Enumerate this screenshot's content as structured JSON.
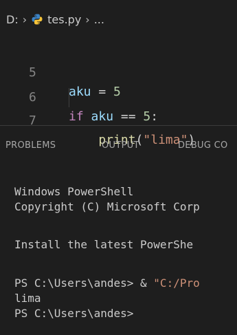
{
  "breadcrumb": {
    "drive": "D:",
    "separator": "›",
    "file": "tes.py",
    "more": "..."
  },
  "editor": {
    "lines": [
      {
        "num": "5",
        "tokens": [
          {
            "t": "aku",
            "c": "var"
          },
          {
            "t": " = ",
            "c": "op"
          },
          {
            "t": "5",
            "c": "num"
          }
        ]
      },
      {
        "num": "6",
        "tokens": [
          {
            "t": "if",
            "c": "kw"
          },
          {
            "t": " ",
            "c": "op"
          },
          {
            "t": "aku",
            "c": "var"
          },
          {
            "t": " == ",
            "c": "op"
          },
          {
            "t": "5",
            "c": "num"
          },
          {
            "t": ":",
            "c": "op"
          }
        ]
      },
      {
        "num": "7",
        "tokens": [
          {
            "t": "    ",
            "c": "op"
          },
          {
            "t": "print",
            "c": "fn"
          },
          {
            "t": "(",
            "c": "op"
          },
          {
            "t": "\"lima\"",
            "c": "str"
          },
          {
            "t": ")",
            "c": "op"
          }
        ]
      }
    ]
  },
  "panel_tabs": {
    "problems": "PROBLEMS",
    "output": "OUTPUT",
    "debug": "DEBUG CO"
  },
  "terminal": {
    "line1": "Windows PowerShell",
    "line2": "Copyright (C) Microsoft Corp",
    "line3": "Install the latest PowerShe",
    "prompt1_path": "PS C:\\Users\\andes>",
    "prompt1_amp": " & ",
    "prompt1_str": "\"C:/Pro",
    "output": "lima",
    "prompt2": "PS C:\\Users\\andes>"
  },
  "colors": {
    "background": "#1e1e1e",
    "keyword": "#c586c0",
    "variable": "#9cdcfe",
    "number": "#b5cea8",
    "function": "#dcdcaa",
    "string": "#ce9178"
  }
}
